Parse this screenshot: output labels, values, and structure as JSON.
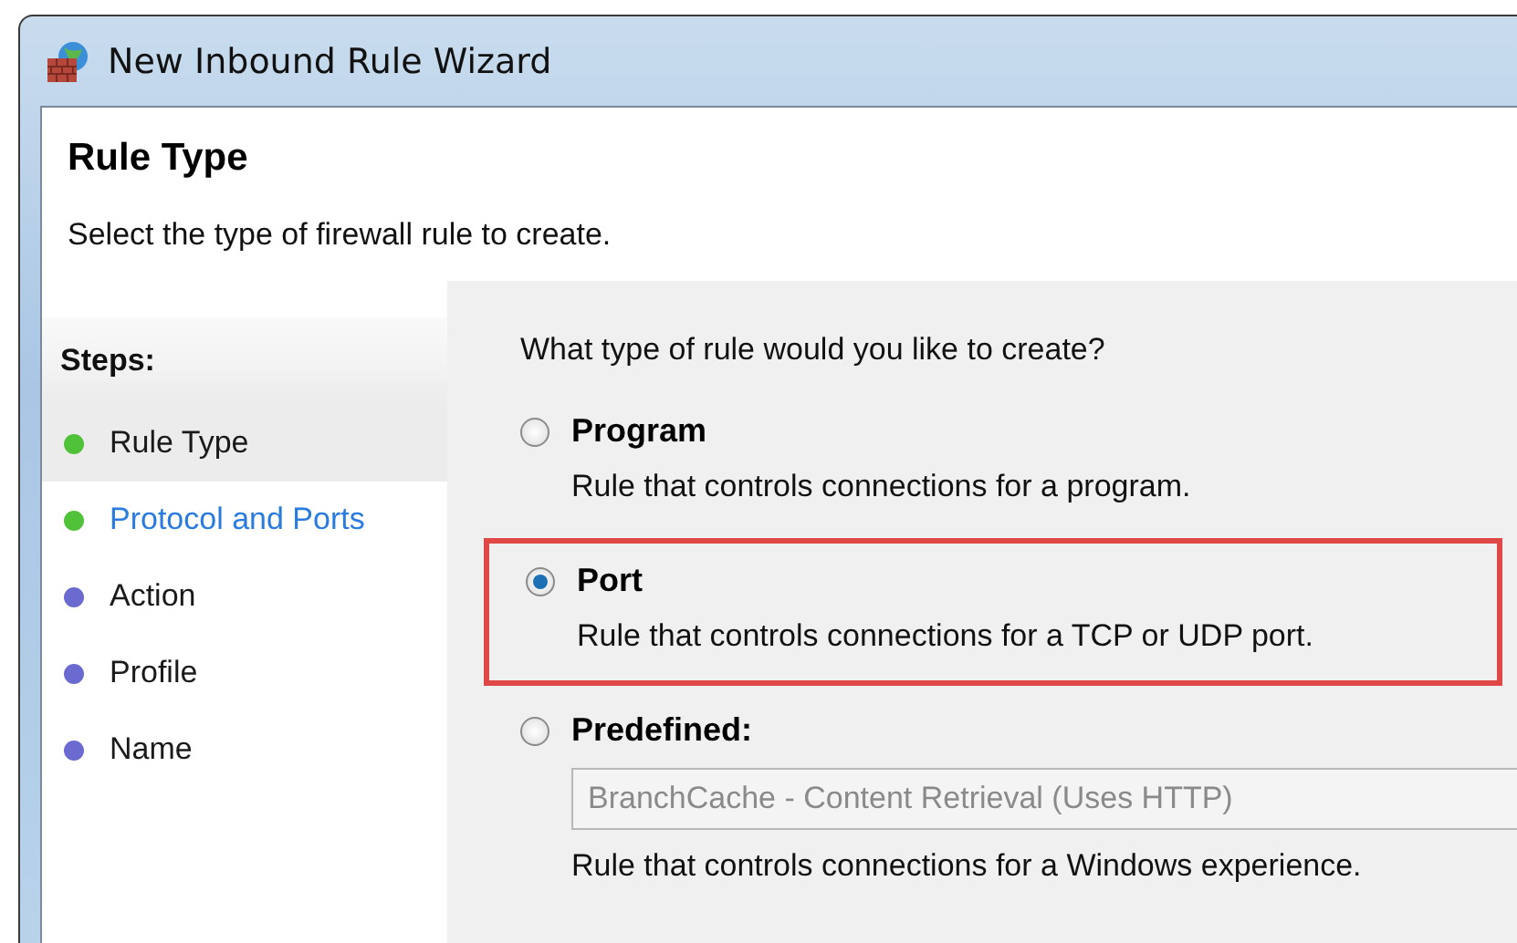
{
  "window": {
    "title": "New Inbound Rule Wizard"
  },
  "header": {
    "title": "Rule Type",
    "subtitle": "Select the type of firewall rule to create."
  },
  "steps": {
    "heading": "Steps:",
    "items": [
      {
        "label": "Rule Type",
        "selected": true,
        "highlighted": false,
        "color": "#4fc23a"
      },
      {
        "label": "Protocol and Ports",
        "selected": false,
        "highlighted": true,
        "color": "#4fc23a"
      },
      {
        "label": "Action",
        "selected": false,
        "highlighted": false,
        "color": "#6a6ad0"
      },
      {
        "label": "Profile",
        "selected": false,
        "highlighted": false,
        "color": "#6a6ad0"
      },
      {
        "label": "Name",
        "selected": false,
        "highlighted": false,
        "color": "#6a6ad0"
      }
    ]
  },
  "question": "What type of rule would you like to create?",
  "options": [
    {
      "label": "Program",
      "selected": false,
      "highlighted": false,
      "description": "Rule that controls connections for a program."
    },
    {
      "label": "Port",
      "selected": true,
      "highlighted": true,
      "description": "Rule that controls connections for a TCP or UDP port."
    },
    {
      "label": "Predefined:",
      "selected": false,
      "highlighted": false,
      "dropdown": {
        "value": "BranchCache - Content Retrieval (Uses HTTP)",
        "disabled": true
      },
      "description": "Rule that controls connections for a Windows experience."
    }
  ]
}
